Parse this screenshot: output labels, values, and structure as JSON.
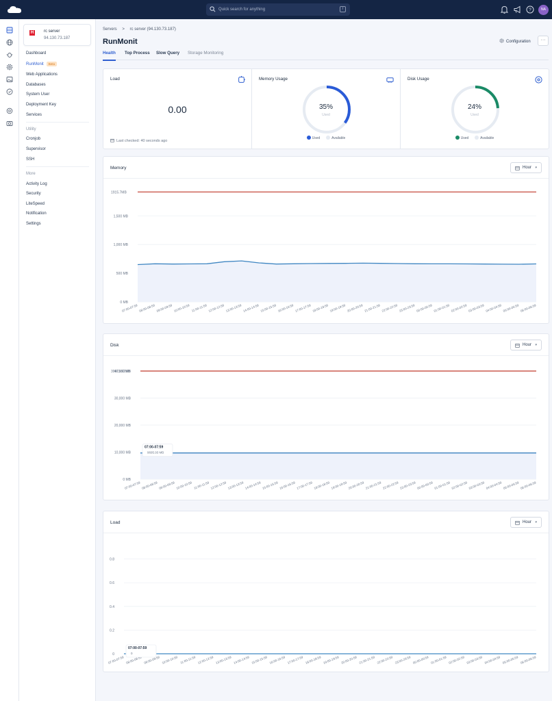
{
  "topbar": {
    "search_placeholder": "Quick search for anything",
    "search_shortcut": "/",
    "avatar_initials": "NA",
    "icons": [
      "bell-icon",
      "megaphone-icon",
      "help-icon"
    ]
  },
  "rail_icons": [
    "server-icon",
    "globe-icon",
    "bug-icon",
    "gear-icon",
    "image-icon",
    "shield-icon",
    "settings-icon",
    "camera-icon"
  ],
  "server": {
    "name": "rc server",
    "ip": "94.130.73.187",
    "logo_letter": "H"
  },
  "sidebar": {
    "items": [
      {
        "label": "Dashboard"
      },
      {
        "label": "RunMonit",
        "badge": "Beta",
        "active": true
      },
      {
        "label": "Web Applications"
      },
      {
        "label": "Databases"
      },
      {
        "label": "System User"
      },
      {
        "label": "Deployment Key"
      },
      {
        "label": "Services"
      }
    ],
    "utility_heading": "Utility",
    "utility_items": [
      {
        "label": "Cronjob"
      },
      {
        "label": "Supervisor"
      },
      {
        "label": "SSH"
      }
    ],
    "more_heading": "More",
    "more_items": [
      {
        "label": "Activity Log"
      },
      {
        "label": "Security"
      },
      {
        "label": "LiteSpeed"
      },
      {
        "label": "Notification"
      },
      {
        "label": "Settings"
      }
    ]
  },
  "breadcrumb": {
    "root": "Servers",
    "separator": ">",
    "current": "rc server (94.130.73.187)"
  },
  "page": {
    "title": "RunMonit",
    "config_label": "Configuration",
    "more_label": "···"
  },
  "tabs": [
    {
      "label": "Health",
      "active": true
    },
    {
      "label": "Top Process"
    },
    {
      "label": "Slow Query"
    },
    {
      "label": "Storage Monitoring"
    }
  ],
  "load_card": {
    "title": "Load",
    "value": "0.00",
    "last_checked": "Last checked: 40 seconds ago"
  },
  "memory_card": {
    "title": "Memory Usage",
    "percent": 35,
    "percent_label": "35%",
    "used_label": "Used",
    "legend_used": "Used",
    "legend_available": "Available",
    "color": "#2a5bd7"
  },
  "disk_card": {
    "title": "Disk Usage",
    "percent": 24,
    "percent_label": "24%",
    "used_label": "Used",
    "legend_used": "Used",
    "legend_available": "Available",
    "color": "#1a8a66"
  },
  "time_labels": [
    "07:00-07:59",
    "08:00-08:59",
    "09:00-09:59",
    "10:00-10:59",
    "11:00-11:59",
    "12:00-12:59",
    "13:00-13:59",
    "14:00-14:59",
    "15:00-15:59",
    "16:00-16:59",
    "17:00-17:59",
    "18:00-18:59",
    "19:00-19:59",
    "20:00-20:59",
    "21:00-21:59",
    "22:00-22:59",
    "23:00-23:59",
    "00:00-00:59",
    "01:00-01:59",
    "02:00-02:59",
    "03:00-03:59",
    "04:00-04:59",
    "05:00-05:59",
    "06:00-06:59"
  ],
  "range_label": "Hour",
  "chart_data": [
    {
      "type": "line",
      "title": "Memory",
      "yticks": [
        "0 MB",
        "500 MB",
        "1,000 MB",
        "1,500 MB"
      ],
      "ylim": [
        0,
        2100
      ],
      "limit_value": 1915.7,
      "limit_label": "1915.7MB",
      "limit_color": "#c0392b",
      "series_color": "#3f86c2",
      "values": [
        650,
        665,
        660,
        662,
        665,
        700,
        715,
        680,
        660,
        665,
        668,
        670,
        672,
        675,
        672,
        668,
        665,
        664,
        663,
        662,
        660,
        658,
        656,
        662
      ]
    },
    {
      "type": "line",
      "title": "Disk",
      "yticks": [
        "0 MB",
        "10,000 MB",
        "20,000 MB",
        "30,000 MB",
        "40,000 MB"
      ],
      "ylim": [
        0,
        42000
      ],
      "limit_value": 39973.92,
      "limit_label": "39973.92MB",
      "limit_color": "#c0392b",
      "series_color": "#3f86c2",
      "values": [
        9695.93,
        9695.93,
        9696,
        9696,
        9696,
        9697,
        9697,
        9697,
        9697,
        9698,
        9698,
        9698,
        9698,
        9698,
        9699,
        9699,
        9699,
        9699,
        9699,
        9700,
        9700,
        9700,
        9700,
        9700
      ],
      "tooltip": {
        "title": "07:00-07:59",
        "value": "9695.93 MB"
      }
    },
    {
      "type": "line",
      "title": "Load",
      "yticks": [
        "0",
        "0.2",
        "0.4",
        "0.6",
        "0.8"
      ],
      "ylim": [
        0,
        0.85
      ],
      "series_color": "#3f86c2",
      "values": [
        0,
        0,
        0,
        0,
        0,
        0,
        0,
        0,
        0,
        0,
        0,
        0,
        0,
        0,
        0,
        0,
        0,
        0,
        0,
        0,
        0,
        0,
        0,
        0
      ],
      "tooltip": {
        "title": "07:00-07:59",
        "value": "0"
      }
    }
  ]
}
